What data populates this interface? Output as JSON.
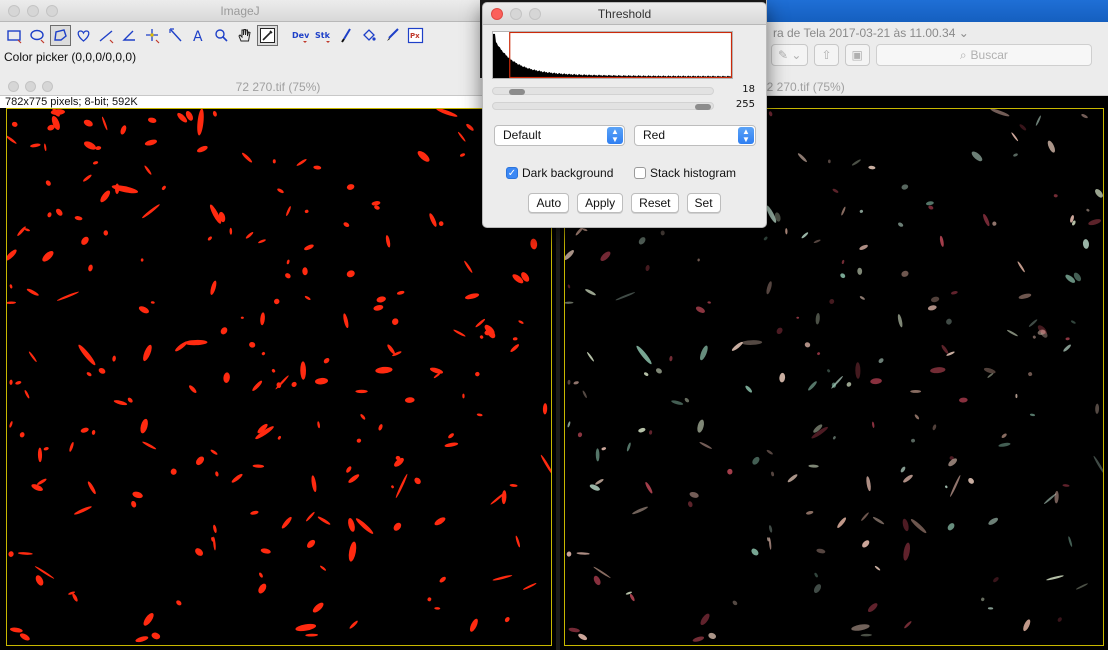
{
  "imagej": {
    "title": "ImageJ",
    "status": "Color picker (0,0,0/0,0,0)",
    "tools": [
      {
        "name": "rectangle-tool-icon",
        "glyph": "rect"
      },
      {
        "name": "oval-tool-icon",
        "glyph": "oval"
      },
      {
        "name": "polygon-tool-icon",
        "glyph": "poly"
      },
      {
        "name": "freehand-tool-icon",
        "glyph": "heart"
      },
      {
        "name": "line-tool-icon",
        "glyph": "line"
      },
      {
        "name": "angle-tool-icon",
        "glyph": "angle"
      },
      {
        "name": "point-tool-icon",
        "glyph": "point"
      },
      {
        "name": "wand-tool-icon",
        "glyph": "wand"
      },
      {
        "name": "text-tool-icon",
        "glyph": "A"
      },
      {
        "name": "magnifier-tool-icon",
        "glyph": "mag"
      },
      {
        "name": "hand-tool-icon",
        "glyph": "hand"
      },
      {
        "name": "color-picker-tool-icon",
        "glyph": "picker"
      },
      {
        "name": "developer-menu-icon",
        "glyph": "Dev"
      },
      {
        "name": "stack-menu-icon",
        "glyph": "Stk"
      },
      {
        "name": "brush-tool-icon",
        "glyph": "brush"
      },
      {
        "name": "flood-fill-tool-icon",
        "glyph": "fill"
      },
      {
        "name": "pencil-tool-icon",
        "glyph": "pencil"
      },
      {
        "name": "pixel-inspector-icon",
        "glyph": "Px"
      }
    ],
    "dev_label": "Dev",
    "stk_label": "Stk",
    "px_label": "Px"
  },
  "preview_window": {
    "title": "ra de Tela 2017-03-21 às 11.00.34 ⌄",
    "search_placeholder": "Buscar"
  },
  "image_left": {
    "title": "72 270.tif (75%)",
    "info": "782x775 pixels; 8-bit; 592K",
    "blob_color": "#ff2a10"
  },
  "image_right": {
    "title": "72 270.tif (75%)"
  },
  "threshold": {
    "title": "Threshold",
    "min_value": "18",
    "max_value": "255",
    "min_fraction": 0.07,
    "max_fraction": 1.0,
    "method": "Default",
    "display": "Red",
    "dark_background_label": "Dark background",
    "dark_background_checked": true,
    "stack_histogram_label": "Stack histogram",
    "stack_histogram_checked": false,
    "buttons": {
      "auto": "Auto",
      "apply": "Apply",
      "reset": "Reset",
      "set": "Set"
    },
    "accent": "#cc2a0a"
  }
}
